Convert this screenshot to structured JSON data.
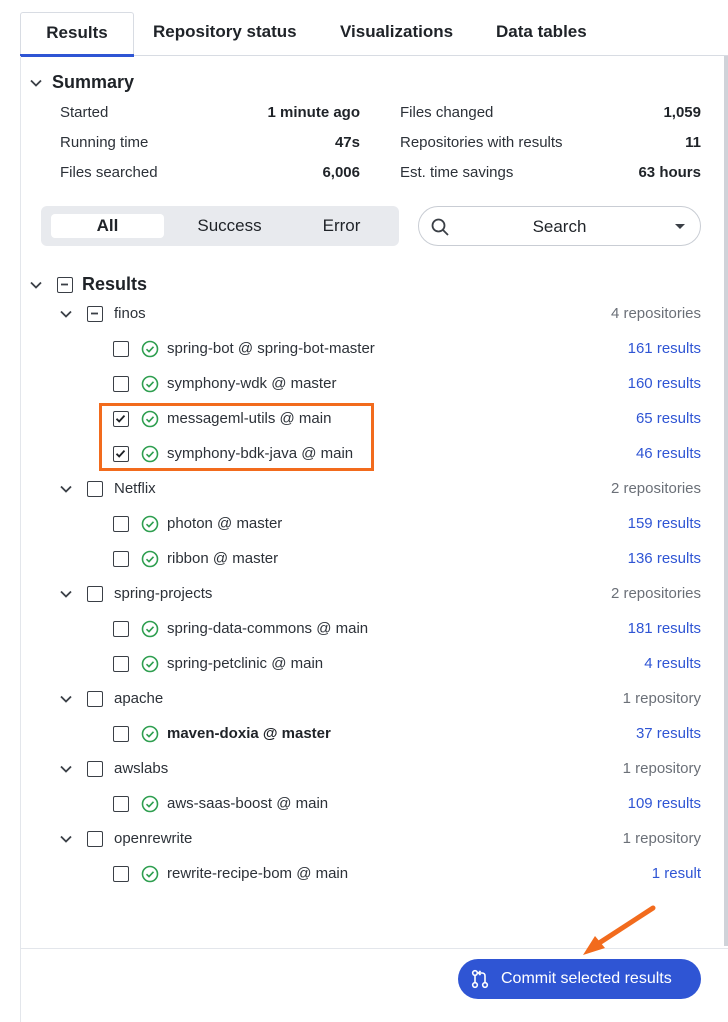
{
  "tabs": [
    {
      "label": "Results",
      "active": true
    },
    {
      "label": "Repository status"
    },
    {
      "label": "Visualizations"
    },
    {
      "label": "Data tables"
    }
  ],
  "summary": {
    "title": "Summary",
    "left": [
      {
        "label": "Started",
        "value": "1 minute ago"
      },
      {
        "label": "Running time",
        "value": "47s"
      },
      {
        "label": "Files searched",
        "value": "6,006"
      }
    ],
    "right": [
      {
        "label": "Files changed",
        "value": "1,059"
      },
      {
        "label": "Repositories with results",
        "value": "11"
      },
      {
        "label": "Est. time savings",
        "value": "63 hours"
      }
    ]
  },
  "filter": {
    "options": [
      "All",
      "Success",
      "Error"
    ],
    "selected": "All"
  },
  "search": {
    "label": "Search"
  },
  "results": {
    "title": "Results",
    "orgs": [
      {
        "name": "finos",
        "count": "4 repositories",
        "state": "indeterminate",
        "repos": [
          {
            "name": "spring-bot @ spring-bot-master",
            "results": "161 results",
            "checked": false
          },
          {
            "name": "symphony-wdk @ master",
            "results": "160 results",
            "checked": false
          },
          {
            "name": "messageml-utils @ main",
            "results": "65 results",
            "checked": true
          },
          {
            "name": "symphony-bdk-java @ main",
            "results": "46 results",
            "checked": true
          }
        ]
      },
      {
        "name": "Netflix",
        "count": "2 repositories",
        "state": "unchecked",
        "repos": [
          {
            "name": "photon @ master",
            "results": "159 results",
            "checked": false
          },
          {
            "name": "ribbon @ master",
            "results": "136 results",
            "checked": false
          }
        ]
      },
      {
        "name": "spring-projects",
        "count": "2 repositories",
        "state": "unchecked",
        "repos": [
          {
            "name": "spring-data-commons @ main",
            "results": "181 results",
            "checked": false
          },
          {
            "name": "spring-petclinic @ main",
            "results": "4 results",
            "checked": false
          }
        ]
      },
      {
        "name": "apache",
        "count": "1 repository",
        "state": "unchecked",
        "repos": [
          {
            "name": "maven-doxia @ master",
            "results": "37 results",
            "checked": false,
            "bold": true
          }
        ]
      },
      {
        "name": "awslabs",
        "count": "1 repository",
        "state": "unchecked",
        "repos": [
          {
            "name": "aws-saas-boost @ main",
            "results": "109 results",
            "checked": false
          }
        ]
      },
      {
        "name": "openrewrite",
        "count": "1 repository",
        "state": "unchecked",
        "repos": [
          {
            "name": "rewrite-recipe-bom @ main",
            "results": "1 result",
            "checked": false
          }
        ]
      }
    ]
  },
  "commit_button": {
    "label": "Commit selected results"
  },
  "colors": {
    "accent": "#2f55d4",
    "highlight": "#f26b1d",
    "success": "#2e9e4f"
  }
}
